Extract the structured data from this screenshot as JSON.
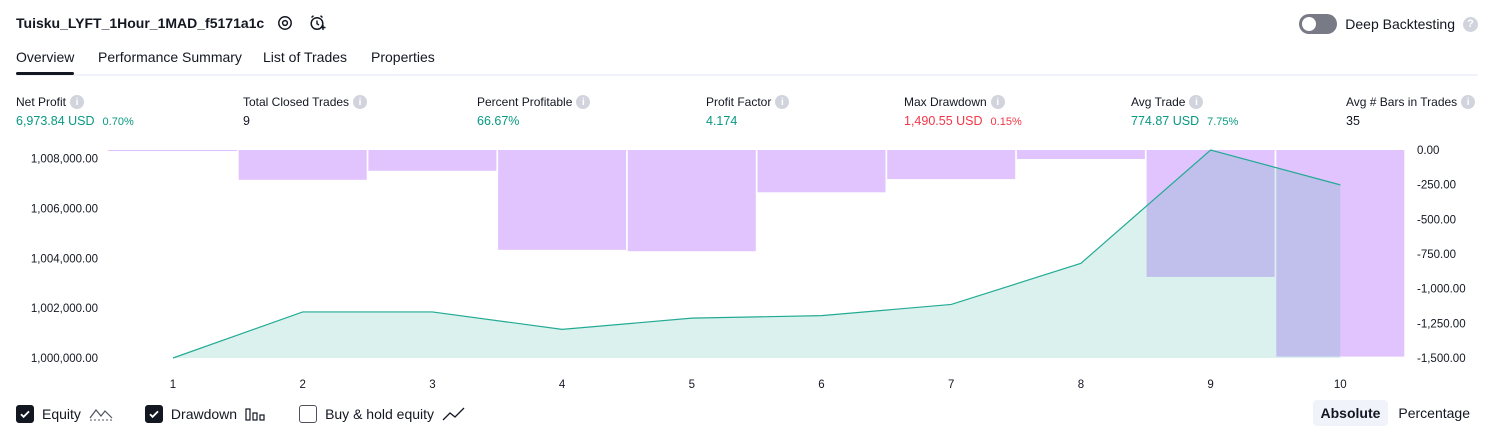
{
  "header": {
    "strategy_name": "Tuisku_LYFT_1Hour_1MAD_f5171a1c",
    "deep_backtesting_label": "Deep Backtesting",
    "deep_backtesting_on": false
  },
  "tabs": [
    {
      "label": "Overview",
      "active": true
    },
    {
      "label": "Performance Summary",
      "active": false
    },
    {
      "label": "List of Trades",
      "active": false
    },
    {
      "label": "Properties",
      "active": false
    }
  ],
  "metrics": [
    {
      "label": "Net Profit",
      "value": "6,973.84 USD",
      "pct": "0.70%",
      "color": "green"
    },
    {
      "label": "Total Closed Trades",
      "value": "9",
      "pct": "",
      "color": "dark"
    },
    {
      "label": "Percent Profitable",
      "value": "66.67%",
      "pct": "",
      "color": "green"
    },
    {
      "label": "Profit Factor",
      "value": "4.174",
      "pct": "",
      "color": "green"
    },
    {
      "label": "Max Drawdown",
      "value": "1,490.55 USD",
      "pct": "0.15%",
      "color": "red"
    },
    {
      "label": "Avg Trade",
      "value": "774.87 USD",
      "pct": "7.75%",
      "color": "green"
    },
    {
      "label": "Avg # Bars in Trades",
      "value": "35",
      "pct": "",
      "color": "dark"
    }
  ],
  "chart_data": {
    "type": "area",
    "x": [
      1,
      2,
      3,
      4,
      5,
      6,
      7,
      8,
      9,
      10
    ],
    "series": [
      {
        "name": "Equity",
        "axis": "left",
        "kind": "area",
        "values": [
          1000000,
          1001850,
          1001850,
          1001150,
          1001600,
          1001700,
          1002150,
          1003800,
          1008350,
          1006950
        ]
      },
      {
        "name": "Drawdown",
        "axis": "right",
        "kind": "bar",
        "values": [
          -5,
          -215,
          -150,
          -720,
          -730,
          -305,
          -210,
          -65,
          -915,
          -1490
        ]
      }
    ],
    "left_axis": {
      "ylim": [
        1000000,
        1008350
      ],
      "ticks": [
        "1,000,000.00",
        "1,002,000.00",
        "1,004,000.00",
        "1,006,000.00",
        "1,008,000.00"
      ]
    },
    "right_axis": {
      "ylim": [
        -1500,
        0
      ],
      "ticks": [
        "0.00",
        "-250.00",
        "-500.00",
        "-750.00",
        "-1,000.00",
        "-1,250.00",
        "-1,500.00"
      ]
    },
    "x_ticks": [
      "1",
      "2",
      "3",
      "4",
      "5",
      "6",
      "7",
      "8",
      "9",
      "10"
    ],
    "colors": {
      "equity_line": "#22ab94",
      "equity_fill": "#22ab94",
      "drawdown": "#e1c4fd"
    }
  },
  "legend": {
    "equity": {
      "label": "Equity",
      "checked": true
    },
    "drawdown": {
      "label": "Drawdown",
      "checked": true
    },
    "buyhold": {
      "label": "Buy & hold equity",
      "checked": false
    }
  },
  "scale_toggle": {
    "absolute": "Absolute",
    "percentage": "Percentage",
    "active": "absolute"
  }
}
